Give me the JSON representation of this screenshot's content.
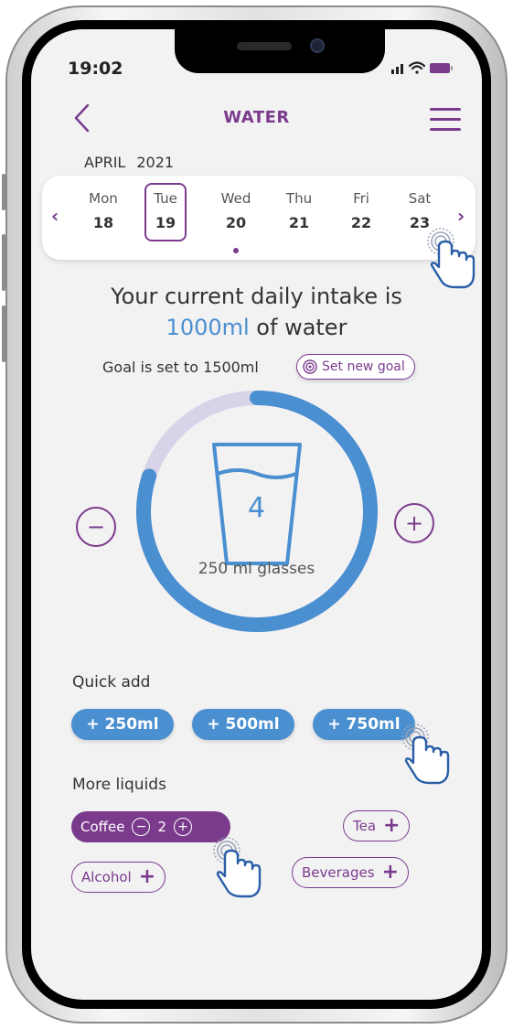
{
  "status_bar": {
    "time": "19:02"
  },
  "header": {
    "title": "WATER"
  },
  "calendar": {
    "month": "APRIL",
    "year": "2021",
    "days": [
      {
        "name": "Mon",
        "num": "18"
      },
      {
        "name": "Tue",
        "num": "19"
      },
      {
        "name": "Wed",
        "num": "20"
      },
      {
        "name": "Thu",
        "num": "21"
      },
      {
        "name": "Fri",
        "num": "22"
      },
      {
        "name": "Sat",
        "num": "23"
      }
    ],
    "selected_day": "Tue"
  },
  "intake": {
    "line1": "Your current daily intake is",
    "amount": "1000ml",
    "suffix": " of water",
    "goal_text": "Goal is set to  1500ml",
    "set_goal_label": "Set new goal",
    "progress_fraction": 0.8
  },
  "glasses": {
    "count": "4",
    "label": "250 ml glasses"
  },
  "quick_add": {
    "label": "Quick add",
    "buttons": [
      "+ 250ml",
      "+ 500ml",
      "+ 750ml"
    ]
  },
  "more_liquids": {
    "label": "More liquids",
    "coffee": {
      "label": "Coffee",
      "count": "2"
    },
    "tea": "Tea",
    "alcohol": "Alcohol",
    "beverages": "Beverages"
  },
  "colors": {
    "accent_purple": "#7b3b8d",
    "water_blue": "#4a8fd0",
    "ring_track": "#d7d4ea"
  }
}
